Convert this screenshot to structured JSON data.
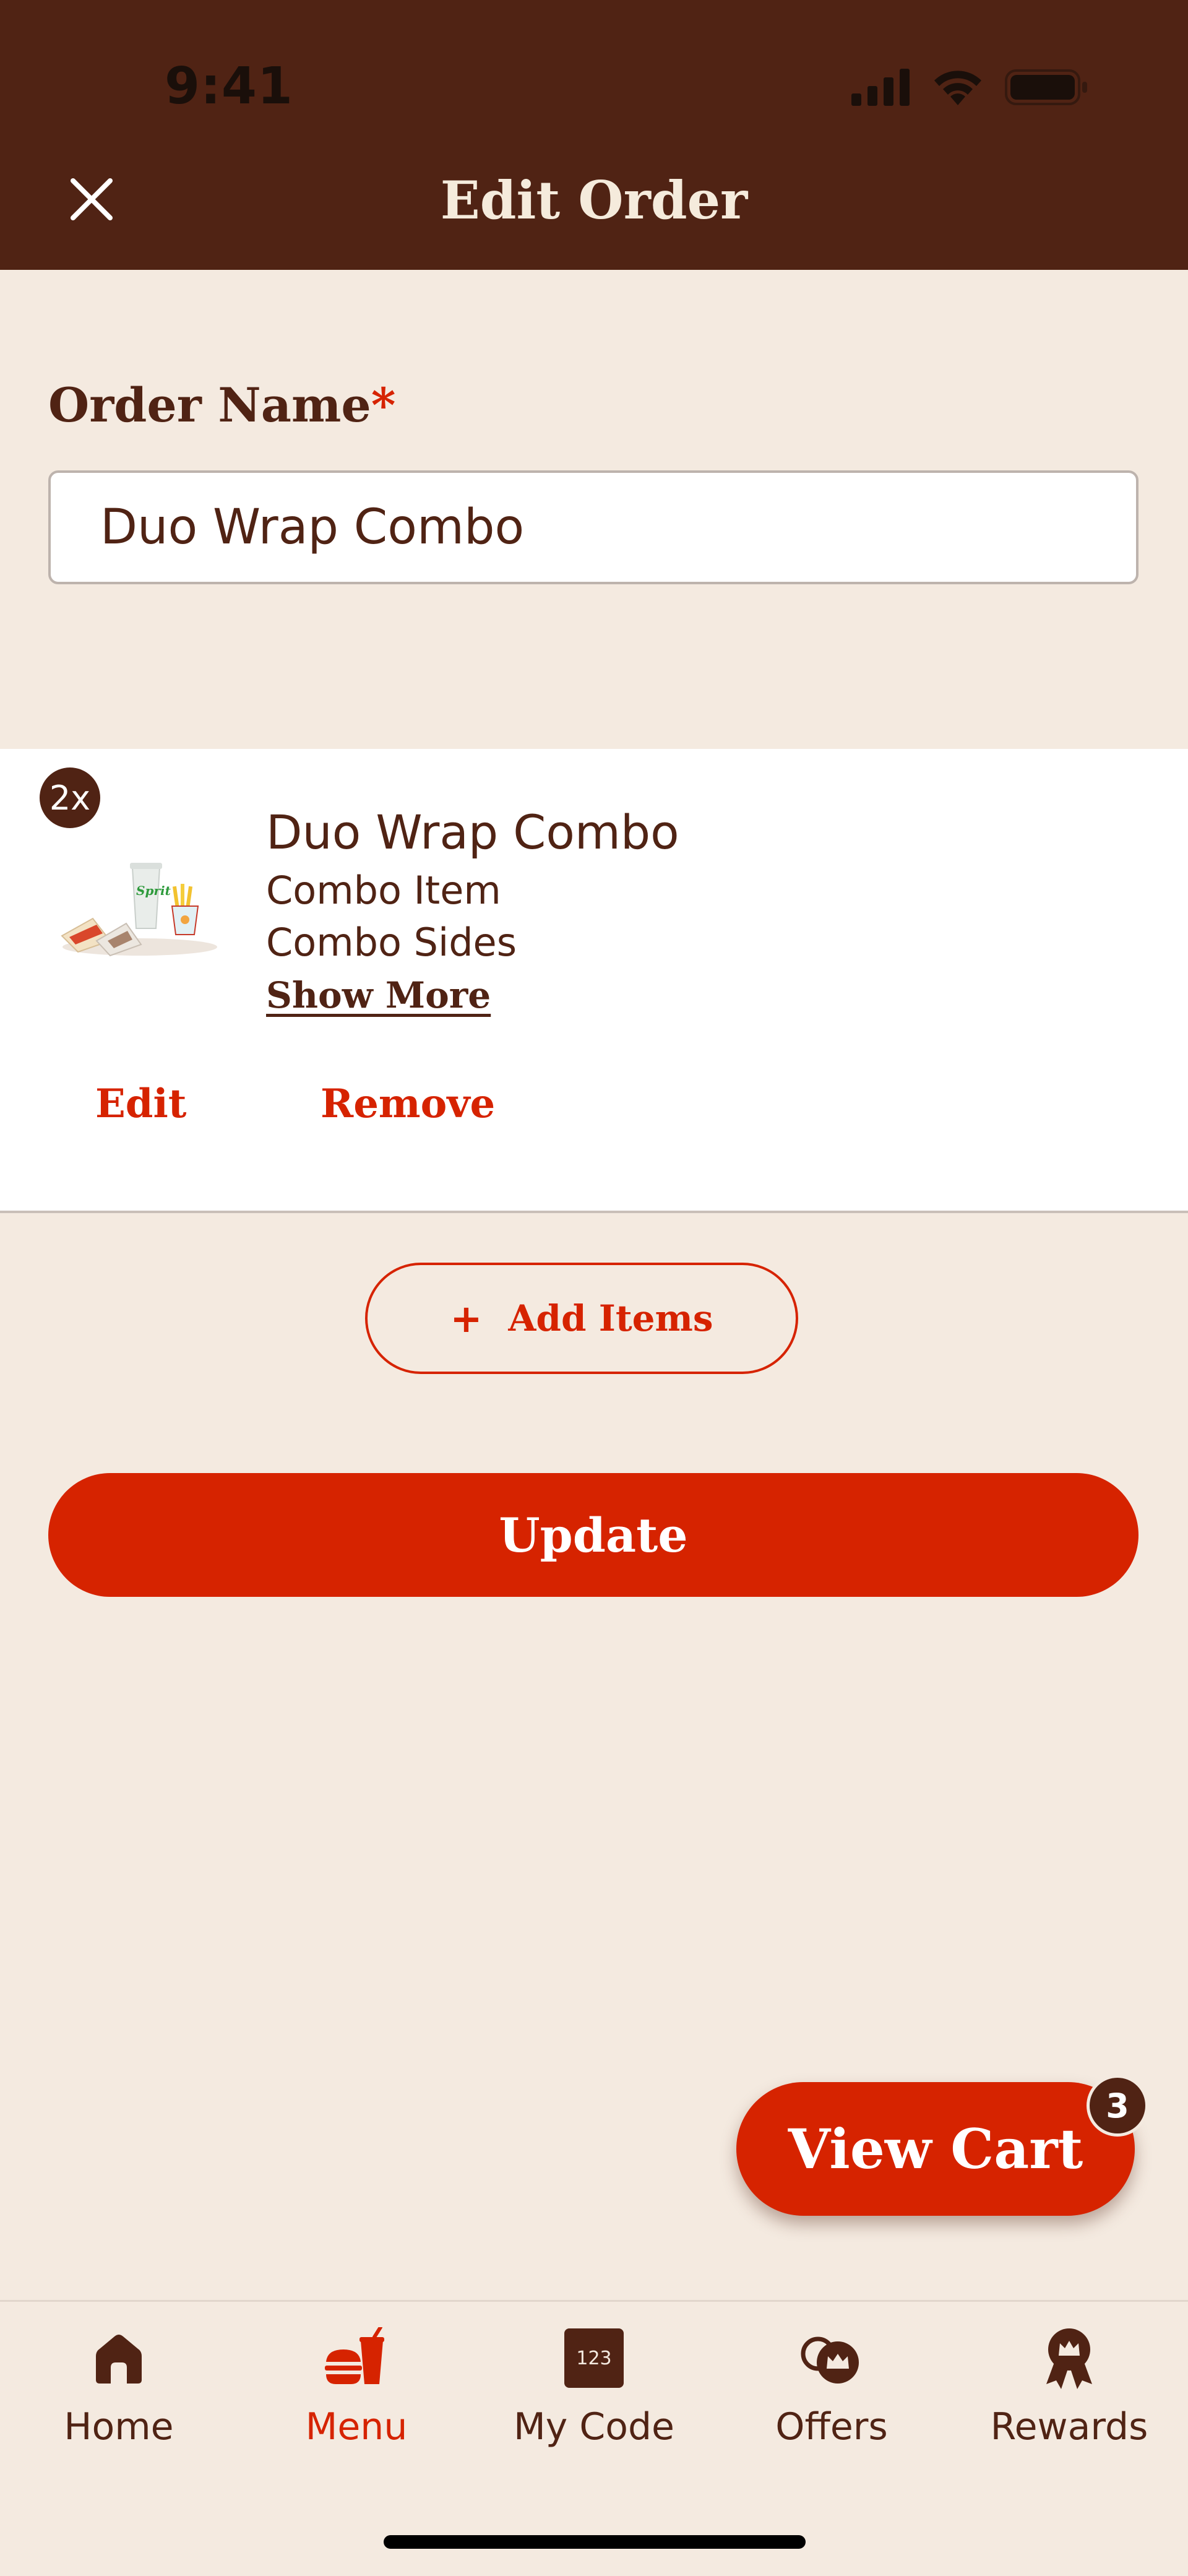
{
  "status_bar": {
    "time": "9:41"
  },
  "header": {
    "title": "Edit Order",
    "close_icon": "close-icon"
  },
  "order_name": {
    "label": "Order Name",
    "required_mark": "*",
    "value": "Duo Wrap Combo"
  },
  "item": {
    "quantity": "2x",
    "name": "Duo Wrap Combo",
    "details": [
      "Combo Item",
      "Combo Sides"
    ],
    "show_more": "Show More",
    "edit_label": "Edit",
    "remove_label": "Remove"
  },
  "add_items": {
    "plus": "+",
    "label": "Add Items"
  },
  "update_label": "Update",
  "view_cart": {
    "label": "View Cart",
    "count": "3"
  },
  "tabs": [
    {
      "label": "Home",
      "icon": "home-icon",
      "active": false
    },
    {
      "label": "Menu",
      "icon": "menu-icon",
      "active": true
    },
    {
      "label": "My Code",
      "icon": "code-icon",
      "icon_text": "123",
      "active": false
    },
    {
      "label": "Offers",
      "icon": "offers-icon",
      "active": false
    },
    {
      "label": "Rewards",
      "icon": "rewards-icon",
      "active": false
    }
  ],
  "colors": {
    "brand_brown": "#502314",
    "brand_red": "#D62300",
    "background": "#F4EAE0",
    "card": "#FFFFFF"
  }
}
